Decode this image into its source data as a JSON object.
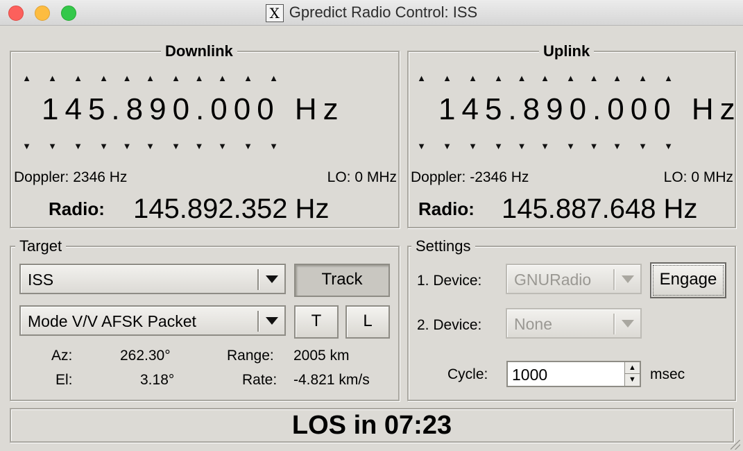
{
  "window": {
    "title": "Gpredict Radio Control: ISS",
    "app_icon": "x11-icon"
  },
  "downlink": {
    "label": "Downlink",
    "frequency": "145.890.000 Hz",
    "doppler": "Doppler: 2346 Hz",
    "lo": "LO:  0 MHz",
    "radio_label": "Radio:",
    "radio_value": "145.892.352 Hz"
  },
  "uplink": {
    "label": "Uplink",
    "frequency": "145.890.000 Hz",
    "doppler": "Doppler: -2346 Hz",
    "lo": "LO:  0 MHz",
    "radio_label": "Radio:",
    "radio_value": "145.887.648 Hz"
  },
  "target": {
    "label": "Target",
    "satellite": "ISS",
    "mode": "Mode V/V AFSK Packet",
    "track_button": "Track",
    "t_button": "T",
    "l_button": "L",
    "az_label": "Az:",
    "az_value": "262.30°",
    "el_label": "El:",
    "el_value": "3.18°",
    "range_label": "Range:",
    "range_value": "2005 km",
    "rate_label": "Rate:",
    "rate_value": "-4.821 km/s"
  },
  "settings": {
    "label": "Settings",
    "device1_label": "1. Device:",
    "device1_value": "GNURadio",
    "engage_button": "Engage",
    "device2_label": "2. Device:",
    "device2_value": "None",
    "cycle_label": "Cycle:",
    "cycle_value": "1000",
    "cycle_unit": "msec"
  },
  "status": {
    "text": "LOS in 07:23"
  },
  "colors": {
    "window_bg": "#dcdad5",
    "close": "#fc605c",
    "minimize": "#fdbc40",
    "zoom": "#34c84a"
  }
}
